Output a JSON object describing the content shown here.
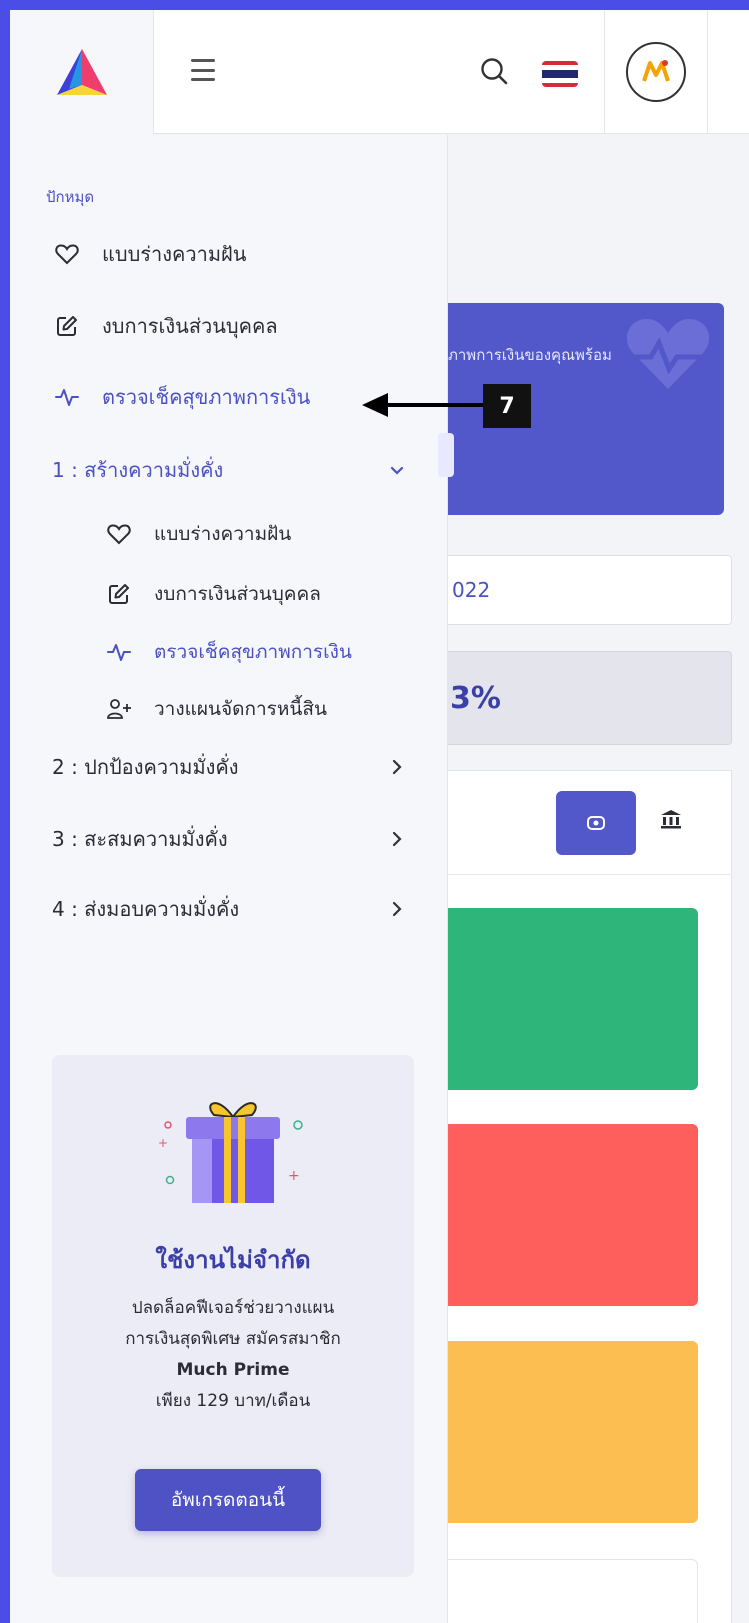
{
  "header": {
    "logo_icon": "triangle-logo-icon",
    "menu_icon": "hamburger-icon",
    "search_icon": "search-icon",
    "flag_icon": "thai-flag-icon",
    "avatar_icon": "much-logo-avatar"
  },
  "sidebar": {
    "section_label": "ปักหมุด",
    "pinned": [
      {
        "label": "แบบร่างความฝัน",
        "icon": "heart-icon"
      },
      {
        "label": "งบการเงินส่วนบุคคล",
        "icon": "edit-icon"
      },
      {
        "label": "ตรวจเช็คสุขภาพการเงิน",
        "icon": "pulse-icon",
        "active": true
      }
    ],
    "groups": [
      {
        "label": "1 : สร้างความมั่งคั่ง",
        "expanded": true,
        "items": [
          {
            "label": "แบบร่างความฝัน",
            "icon": "heart-icon"
          },
          {
            "label": "งบการเงินส่วนบุคคล",
            "icon": "edit-icon"
          },
          {
            "label": "ตรวจเช็คสุขภาพการเงิน",
            "icon": "pulse-icon",
            "active": true
          },
          {
            "label": "วางแผนจัดการหนี้สิน",
            "icon": "user-plus-icon"
          }
        ]
      },
      {
        "label": "2 : ปกป้องความมั่งคั่ง",
        "expanded": false
      },
      {
        "label": "3 : สะสมความมั่งคั่ง",
        "expanded": false
      },
      {
        "label": "4 : ส่งมอบความมั่งคั่ง",
        "expanded": false
      }
    ],
    "promo": {
      "icon": "gift-icon",
      "title": "ใช้งานไม่จำกัด",
      "desc_line1": "ปลดล็อคฟีเจอร์ช่วยวางแผน",
      "desc_line2": "การเงินสุดพิเศษ สมัครสมาชิก",
      "desc_line3": "Much Prime",
      "desc_line4": "เพียง 129 บาท/เดือน",
      "button": "อัพเกรดตอนนี้"
    }
  },
  "content": {
    "banner_text": "ภาพการเงินของคุณพร้อม",
    "date_partial": "022",
    "percent_partial": "3%"
  },
  "annotation": {
    "step": "7"
  },
  "colors": {
    "background": "#4a4ee6",
    "accent": "#4b50c2",
    "green": "#2db57a",
    "red": "#fe5f5d",
    "yellow": "#fdbe51"
  }
}
